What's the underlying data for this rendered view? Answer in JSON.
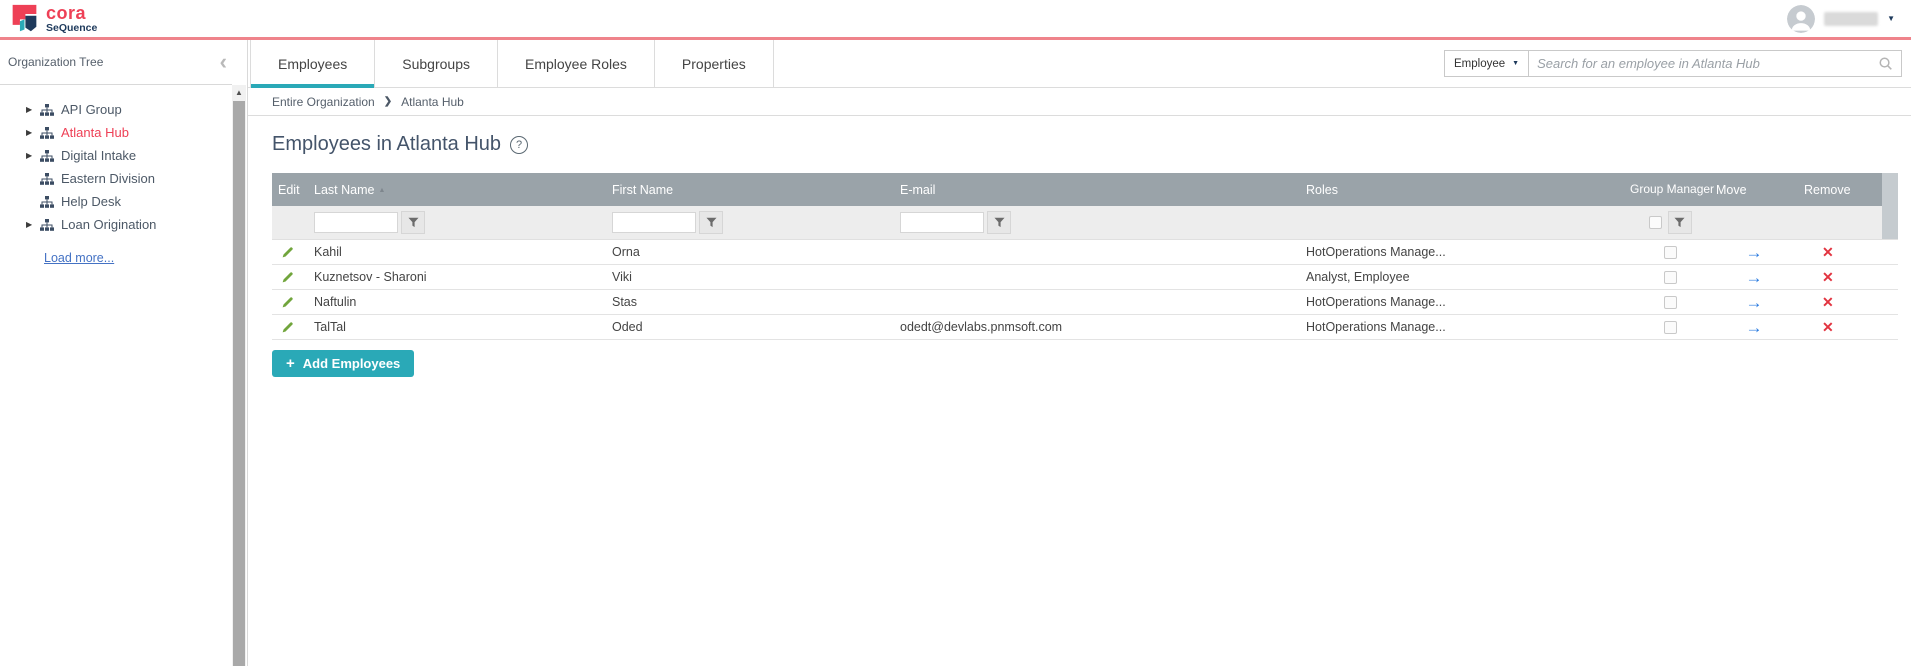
{
  "brand": {
    "logo_text": "cora",
    "logo_subtext": "SeQuence"
  },
  "glyphs": {
    "caret_down": "▼",
    "chevron_left": "‹",
    "scroll_up": "▲",
    "expander": "▶",
    "breadcrumb_sep": "❯",
    "sort_asc": "▲",
    "help": "?",
    "plus": "+",
    "move": "→",
    "remove": "✕"
  },
  "sidebar": {
    "title": "Organization Tree",
    "tree": [
      {
        "label": "API Group",
        "expandable": true,
        "selected": false
      },
      {
        "label": "Atlanta Hub",
        "expandable": true,
        "selected": true
      },
      {
        "label": "Digital Intake",
        "expandable": true,
        "selected": false
      },
      {
        "label": "Eastern Division",
        "expandable": false,
        "selected": false
      },
      {
        "label": "Help Desk",
        "expandable": false,
        "selected": false
      },
      {
        "label": "Loan Origination",
        "expandable": true,
        "selected": false
      }
    ],
    "load_more_label": "Load more..."
  },
  "tabs": [
    {
      "label": "Employees",
      "active": true
    },
    {
      "label": "Subgroups",
      "active": false
    },
    {
      "label": "Employee Roles",
      "active": false
    },
    {
      "label": "Properties",
      "active": false
    }
  ],
  "search": {
    "scope_selected": "Employee",
    "placeholder": "Search for an employee in Atlanta Hub"
  },
  "breadcrumb": {
    "items": [
      "Entire Organization",
      "Atlanta Hub"
    ]
  },
  "page": {
    "title": "Employees in Atlanta Hub"
  },
  "grid": {
    "headers": {
      "edit": "Edit",
      "last_name": "Last Name",
      "first_name": "First Name",
      "email": "E-mail",
      "roles": "Roles",
      "group_manager": "Group Manager",
      "move": "Move",
      "remove": "Remove"
    },
    "sort": {
      "column": "Last Name",
      "direction": "asc"
    },
    "rows": [
      {
        "last_name": "Kahil",
        "first_name": "Orna",
        "email": "",
        "roles": "HotOperations Manage...",
        "group_manager": false
      },
      {
        "last_name": "Kuznetsov - Sharoni",
        "first_name": "Viki",
        "email": "",
        "roles": "Analyst, Employee",
        "group_manager": false
      },
      {
        "last_name": "Naftulin",
        "first_name": "Stas",
        "email": "",
        "roles": "HotOperations Manage...",
        "group_manager": false
      },
      {
        "last_name": "TalTal",
        "first_name": "Oded",
        "email": "odedt@devlabs.pnmsoft.com",
        "roles": "HotOperations Manage...",
        "group_manager": false
      }
    ]
  },
  "actions": {
    "add_employees_label": "Add Employees"
  },
  "colors": {
    "brand_pink": "#ee4056",
    "topbar_divider": "#ef838b",
    "accent_teal": "#2aa9b7",
    "grid_header_bg": "#9aa3a9",
    "link_blue": "#4472c4",
    "move_blue": "#2b7be0",
    "remove_red": "#e23440",
    "edit_green": "#71a53c",
    "title_color": "#44546a",
    "navy": "#1e3a5c"
  }
}
